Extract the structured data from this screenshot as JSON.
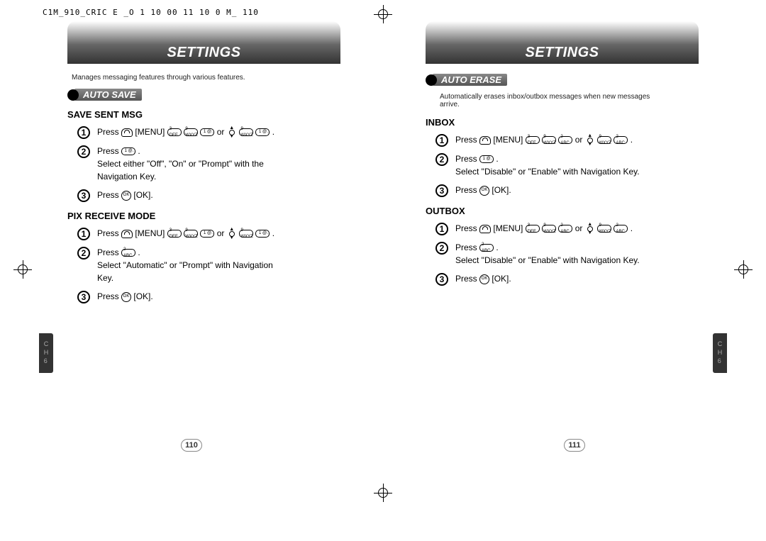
{
  "doc_header_line": "C1M_910_CRIC E _O 1 10  00 11 10  0 M_  110",
  "left": {
    "title": "Settings",
    "intro": "Manages messaging features through various features.",
    "section_label": "Auto Save",
    "sub1": "SAVE SENT MSG",
    "sub1_step1_a": "Press ",
    "sub1_step1_b": " [MENU] ",
    "sub1_step1_or": " or ",
    "sub1_step1_end": " .",
    "sub1_step2_a": "Press ",
    "sub1_step2_b": "Select either \"Off\", \"On\" or \"Prompt\" with the Navigation Key.",
    "sub1_step3_a": "Press ",
    "sub1_step3_b": " [OK].",
    "sub2": "PIX RECEIVE MODE",
    "sub2_step1_a": "Press ",
    "sub2_step1_b": " [MENU] ",
    "sub2_step1_or": " or ",
    "sub2_step1_end": " .",
    "sub2_step2_a": "Press ",
    "sub2_step2_b": "Select \"Automatic\" or \"Prompt\" with Navigation Key.",
    "sub2_step3_a": "Press ",
    "sub2_step3_b": " [OK].",
    "page_num": "110",
    "ch": "C\nH\n6"
  },
  "right": {
    "title": "Settings",
    "section_label": "Auto Erase",
    "intro": "Automatically erases inbox/outbox messages when new messages arrive.",
    "sub1": "INBOX",
    "sub1_step1_a": "Press ",
    "sub1_step1_b": " [MENU] ",
    "sub1_step1_or": " or ",
    "sub1_step1_end": " .",
    "sub1_step2_a": "Press ",
    "sub1_step2_b": "Select \"Disable\" or \"Enable\" with Navigation Key.",
    "sub1_step3_a": "Press ",
    "sub1_step3_b": " [OK].",
    "sub2": "OUTBOX",
    "sub2_step1_a": "Press ",
    "sub2_step1_b": " [MENU] ",
    "sub2_step1_or": " or ",
    "sub2_step1_end": " .",
    "sub2_step2_a": "Press ",
    "sub2_step2_b": "Select \"Disable\" or \"Enable\" with Navigation Key.",
    "sub2_step3_a": "Press ",
    "sub2_step3_b": " [OK].",
    "page_num": "111",
    "ch": "C\nH\n6"
  },
  "keys": {
    "three": "3 DEF",
    "nine": "9 WXYZ",
    "one": "1 @.",
    "two": "2 ABC",
    "ok": "OK"
  }
}
